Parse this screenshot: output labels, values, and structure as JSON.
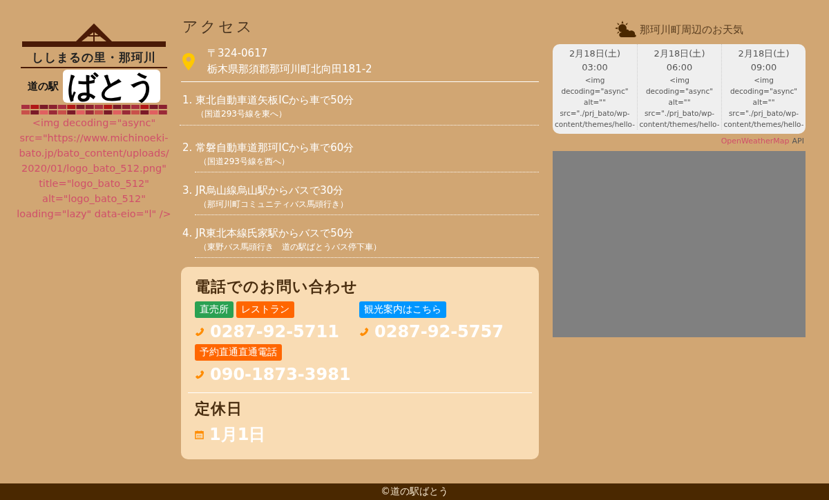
{
  "logo": {
    "tagline": "ししまるの里・那珂川",
    "prefix": "道の駅",
    "name": "ばとう",
    "broken_image_text": "<img decoding=\"async\" src=\"https://www.michinoeki-bato.jp/bato_content/uploads/2020/01/logo_bato_512.png\" title=\"logo_bato_512\" alt=\"logo_bato_512\" loading=\"lazy\" data-eio=\"l\" />"
  },
  "access": {
    "title": "アクセス",
    "postal_code": "〒324-0617",
    "address": "栃木県那須郡那珂川町北向田181-2",
    "routes": [
      {
        "number": "1.",
        "route": "東北自動車道矢板ICから車で50分",
        "note": "（国道293号線を東へ）"
      },
      {
        "number": "2.",
        "route": "常磐自動車道那珂ICから車で60分",
        "note": "（国道293号線を西へ）"
      },
      {
        "number": "3.",
        "route": "JR烏山線烏山駅からバスで30分",
        "note": "（那珂川町コミュニティバス馬頭行き）"
      },
      {
        "number": "4.",
        "route": "JR東北本線氏家駅からバスで50分",
        "note": "（東野バス馬頭行き　道の駅ばとうバス停下車）"
      }
    ]
  },
  "contact": {
    "title": "電話でのお問い合わせ",
    "phones": [
      {
        "tags": [
          {
            "label": "直売所",
            "color": "#2aa152"
          },
          {
            "label": "レストラン",
            "color": "#ff6600"
          }
        ],
        "number": "0287-92-5711"
      },
      {
        "tags": [
          {
            "label": "観光案内はこちら",
            "color": "#0096ff"
          }
        ],
        "number": "0287-92-5757"
      },
      {
        "tags": [
          {
            "label": "予約直通直通電話",
            "color": "#ff6600"
          }
        ],
        "number": "090-1873-3981"
      }
    ],
    "holiday_title": "定休日",
    "holiday": "1月1日"
  },
  "weather": {
    "title": "那珂川町周辺のお天気",
    "forecasts": [
      {
        "date": "2月18日(土)",
        "time": "03:00",
        "alt_lines": [
          "<img",
          "decoding=\"async\"",
          "alt=\"\"",
          "src=\"./prj_bato/wp-",
          "content/themes/hello-"
        ]
      },
      {
        "date": "2月18日(土)",
        "time": "06:00",
        "alt_lines": [
          "<img",
          "decoding=\"async\"",
          "alt=\"\"",
          "src=\"./prj_bato/wp-",
          "content/themes/hello-"
        ]
      },
      {
        "date": "2月18日(土)",
        "time": "09:00",
        "alt_lines": [
          "<img",
          "decoding=\"async\"",
          "alt=\"\"",
          "src=\"./prj_bato/wp-",
          "content/themes/hello-"
        ]
      }
    ],
    "credit_link": "OpenWeatherMap",
    "credit_suffix": "API"
  },
  "footer": {
    "copyright": "©道の駅ばとう"
  }
}
